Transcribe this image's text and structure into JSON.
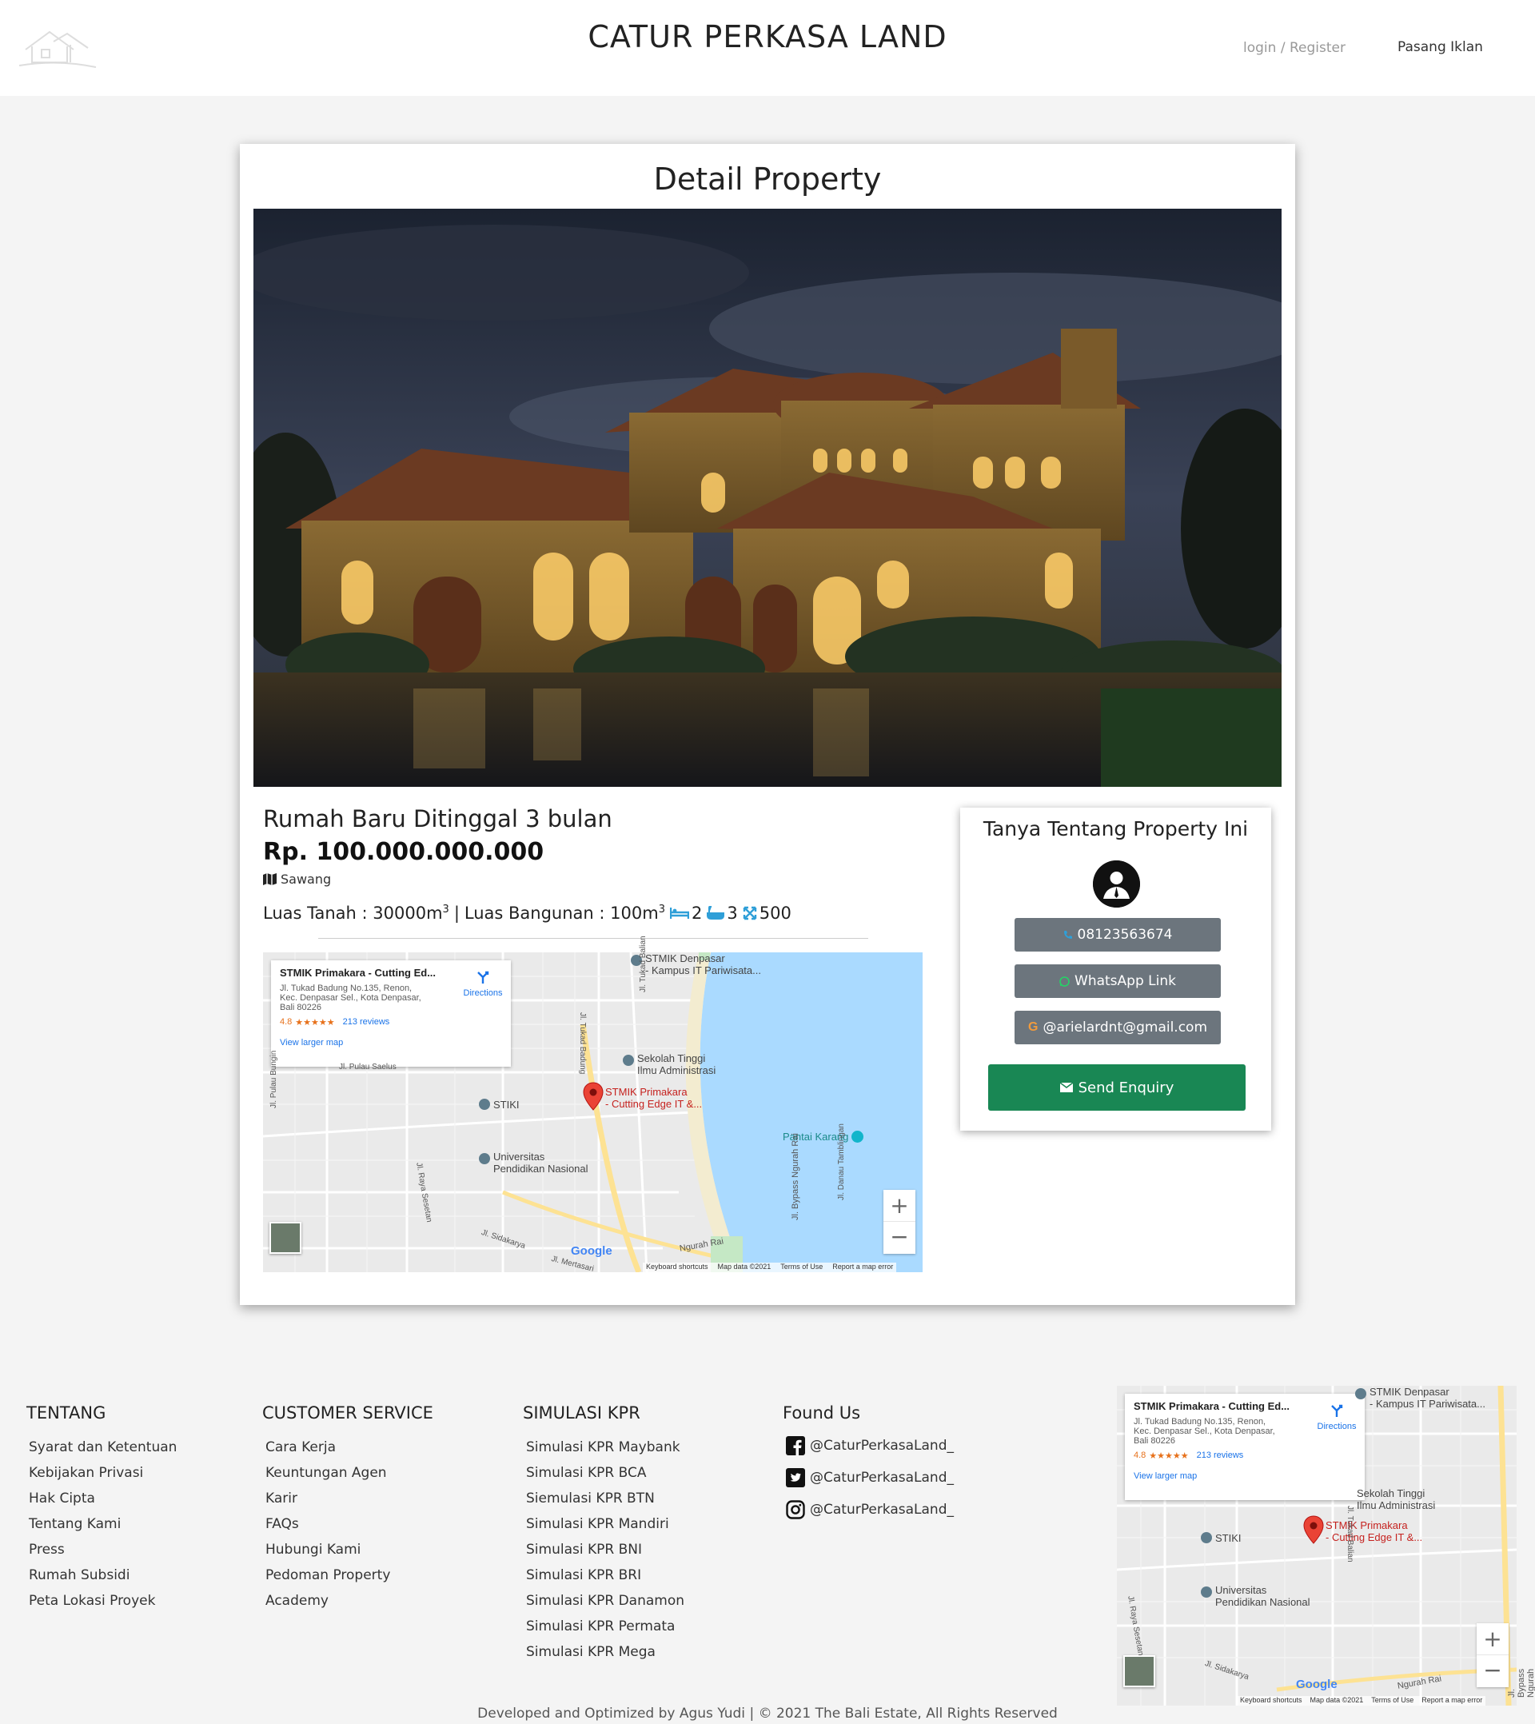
{
  "header": {
    "site_title": "CATUR PERKASA LAND",
    "login_link": "login / Register",
    "post_ad_link": "Pasang Iklan"
  },
  "detail": {
    "heading": "Detail Property",
    "title": "Rumah Baru Ditinggal 3 bulan",
    "price": "Rp. 100.000.000.000",
    "location": "Sawang",
    "land_area_label": "Luas Tanah : 30000m",
    "land_area_sup": "3",
    "separator": "|",
    "building_area_label": "Luas Bangunan : 100m",
    "building_area_sup": "3",
    "bedrooms": "2",
    "bathrooms": "3",
    "size": "500"
  },
  "map": {
    "place_name": "STMIK Primakara - Cutting Ed...",
    "address_line1": "Jl. Tukad Badung No.135, Renon,",
    "address_line2": "Kec. Denpasar Sel., Kota Denpasar,",
    "address_line3": "Bali 80226",
    "rating": "4.8",
    "stars": "★★★★★",
    "reviews": "213 reviews",
    "directions": "Directions",
    "larger_map": "View larger map",
    "marker_label1": "STMIK Primakara",
    "marker_label2": "- Cutting Edge IT &...",
    "poi_stmik_dps1": "STMIK Denpasar",
    "poi_stmik_dps2": "- Kampus IT Pariwisata...",
    "poi_sekolah1": "Sekolah Tinggi",
    "poi_sekolah2": "Ilmu Administrasi",
    "poi_stiki": "STIKI",
    "poi_univ1": "Universitas",
    "poi_univ2": "Pendidikan Nasional",
    "poi_pantai": "Pantai Karang",
    "road_pulau_saelus": "Jl. Pulau Saelus",
    "road_pulau_bungin": "Jl. Pulau Bungin",
    "road_tukad_badung": "Jl. Tukad Badung",
    "road_tukad_balian": "Jl. Tukad Balian",
    "road_bypass": "Jl. Bypass Ngurah Rai",
    "road_danau": "Jl. Danau Tamblingan",
    "road_raya_sesetan": "Jl. Raya Sesetan",
    "road_sidakarya": "Jl. Sidakarya",
    "road_ngurah_rai": "Ngurah Rai",
    "road_mertasari": "Jl. Mertasari",
    "footer_keyboard": "Keyboard shortcuts",
    "footer_mapdata": "Map data ©2021",
    "footer_terms": "Terms of Use",
    "footer_report": "Report a map error",
    "google": "Google",
    "zoom_in": "+",
    "zoom_out": "−"
  },
  "enquiry": {
    "title": "Tanya Tentang Property Ini",
    "phone": "08123563674",
    "whatsapp": "WhatsApp Link",
    "email": "@arielardnt@gmail.com",
    "send": "Send Enquiry"
  },
  "footer": {
    "tentang": {
      "heading": "TENTANG",
      "links": [
        "Syarat dan Ketentuan",
        "Kebijakan Privasi",
        "Hak Cipta",
        "Tentang Kami",
        "Press",
        "Rumah Subsidi",
        "Peta Lokasi Proyek"
      ]
    },
    "cs": {
      "heading": "CUSTOMER SERVICE",
      "links": [
        "Cara Kerja",
        "Keuntungan Agen",
        "Karir",
        "FAQs",
        "Hubungi Kami",
        "Pedoman Property",
        "Academy"
      ]
    },
    "kpr": {
      "heading": "SIMULASI KPR",
      "links": [
        "Simulasi KPR Maybank",
        "Simulasi KPR BCA",
        "Siemulasi KPR BTN",
        "Simulasi KPR Mandiri",
        "Simulasi KPR BNI",
        "Simulasi KPR BRI",
        "Simulasi KPR Danamon",
        "Simulasi KPR Permata",
        "Simulasi KPR Mega"
      ]
    },
    "found": {
      "heading": "Found Us",
      "facebook": "@CaturPerkasaLand_",
      "twitter": "@CaturPerkasaLand_",
      "instagram": "@CaturPerkasaLand_"
    },
    "copyright": "Developed and Optimized by Agus Yudi | © 2021 The Bali Estate, All Rights Reserved"
  },
  "colors": {
    "accent_blue": "#2f9fd8",
    "send_green": "#198754",
    "button_grey": "#6c757d",
    "map_water": "#aadaff",
    "marker_red": "#ea4335"
  }
}
